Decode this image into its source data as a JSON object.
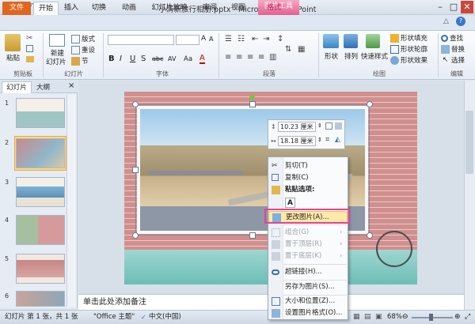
{
  "window": {
    "title": "小清新旅行相册.pptx - Microsoft PowerPoint",
    "context_tab": "图片工具"
  },
  "tabs": [
    "文件",
    "开始",
    "插入",
    "切换",
    "动画",
    "幻灯片放映",
    "审阅",
    "视图",
    "格式"
  ],
  "ribbon": {
    "clipboard": {
      "paste": "粘贴",
      "group": "剪贴板"
    },
    "slides": {
      "new_slide_1": "新建",
      "new_slide_2": "幻灯片",
      "layout": "版式",
      "reset": "重设",
      "section": "节",
      "group": "幻灯片"
    },
    "font": {
      "group": "字体",
      "bold": "B",
      "italic": "I",
      "underline": "U",
      "shadow": "S",
      "strike": "abc",
      "spacing": "AV",
      "case": "Aa",
      "color": "A"
    },
    "paragraph": {
      "group": "段落"
    },
    "drawing": {
      "group": "绘图",
      "shapes": "形状",
      "arrange": "排列",
      "quick_styles": "快速样式",
      "fill": "形状填充",
      "outline": "形状轮廓",
      "effects": "形状效果"
    },
    "editing": {
      "group": "编辑",
      "find": "查找",
      "replace": "替换",
      "select": "选择"
    }
  },
  "pane": {
    "tab_slides": "幻灯片",
    "tab_outline": "大纲",
    "close": "×",
    "thumbs": [
      "1",
      "2",
      "3",
      "4",
      "5",
      "6"
    ]
  },
  "notes": {
    "placeholder": "单击此处添加备注"
  },
  "minitoolbar": {
    "height": "10.23 厘米",
    "width": "18.18 厘米"
  },
  "contextmenu": {
    "items": [
      {
        "label": "剪切(T)",
        "disabled": false
      },
      {
        "label": "复制(C)",
        "disabled": false
      },
      {
        "label": "粘贴选项:",
        "disabled": false
      },
      {
        "label": "更改图片(A)...",
        "disabled": false
      },
      {
        "label": "组合(G)",
        "disabled": true
      },
      {
        "label": "置于顶层(R)",
        "disabled": true
      },
      {
        "label": "置于底层(K)",
        "disabled": true
      },
      {
        "label": "超链接(H)...",
        "disabled": false
      },
      {
        "label": "另存为图片(S)...",
        "disabled": false
      },
      {
        "label": "大小和位置(Z)...",
        "disabled": false
      },
      {
        "label": "设置图片格式(O)...",
        "disabled": false
      }
    ]
  },
  "status": {
    "slide": "幻灯片 第 1 张，共 1 张",
    "theme": "\"Office 主题\"",
    "lang": "中文(中国)",
    "zoom": "68%"
  }
}
